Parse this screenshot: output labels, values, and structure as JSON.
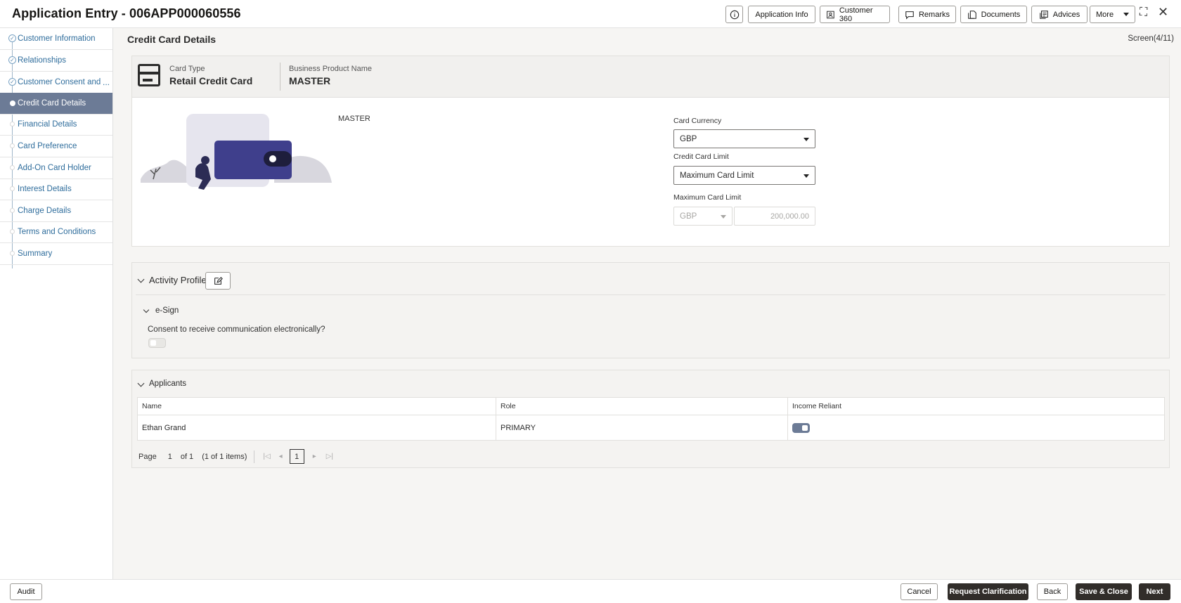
{
  "header": {
    "title": "Application Entry - 006APP000060556",
    "buttons": {
      "info_icon": "info-icon",
      "application_info": "Application Info",
      "customer_360": "Customer 360",
      "remarks": "Remarks",
      "documents": "Documents",
      "advices": "Advices",
      "more": "More"
    }
  },
  "sidebar": {
    "items": [
      {
        "label": "Customer Information",
        "state": "done"
      },
      {
        "label": "Relationships",
        "state": "done"
      },
      {
        "label": "Customer Consent and",
        "state": "done"
      },
      {
        "label": "Credit Card Details",
        "state": "active"
      },
      {
        "label": "Financial Details",
        "state": "pending"
      },
      {
        "label": "Card Preference",
        "state": "pending"
      },
      {
        "label": "Add-On Card Holder",
        "state": "pending"
      },
      {
        "label": "Interest Details",
        "state": "pending"
      },
      {
        "label": "Charge Details",
        "state": "pending"
      },
      {
        "label": "Terms and Conditions",
        "state": "pending"
      },
      {
        "label": "Summary",
        "state": "pending"
      }
    ],
    "ellipsis": "..."
  },
  "main": {
    "title": "Credit Card Details",
    "screen": "Screen(4/11)",
    "card": {
      "card_type_label": "Card Type",
      "card_type_value": "Retail Credit Card",
      "product_label": "Business Product Name",
      "product_value": "MASTER",
      "image_caption": "MASTER",
      "currency_label": "Card Currency",
      "currency_value": "GBP",
      "limit_label": "Credit Card Limit",
      "limit_value": "Maximum Card Limit",
      "max_limit_label": "Maximum Card Limit",
      "max_limit_currency": "GBP",
      "max_limit_amount": "200,000.00"
    },
    "activity": {
      "title": "Activity Profile",
      "esign_title": "e-Sign",
      "consent_label": "Consent to receive communication electronically?",
      "consent_on": false
    },
    "applicants": {
      "title": "Applicants",
      "columns": [
        "Name",
        "Role",
        "Income Reliant"
      ],
      "rows": [
        {
          "name": "Ethan Grand",
          "role": "PRIMARY",
          "income_reliant": true
        }
      ],
      "pager": {
        "page_label": "Page",
        "page": "1",
        "of_label": "of 1",
        "items": "(1 of 1 items)",
        "current": "1"
      }
    }
  },
  "footer": {
    "audit": "Audit",
    "cancel": "Cancel",
    "request_clarification": "Request Clarification",
    "back": "Back",
    "save_close": "Save & Close",
    "next": "Next"
  }
}
